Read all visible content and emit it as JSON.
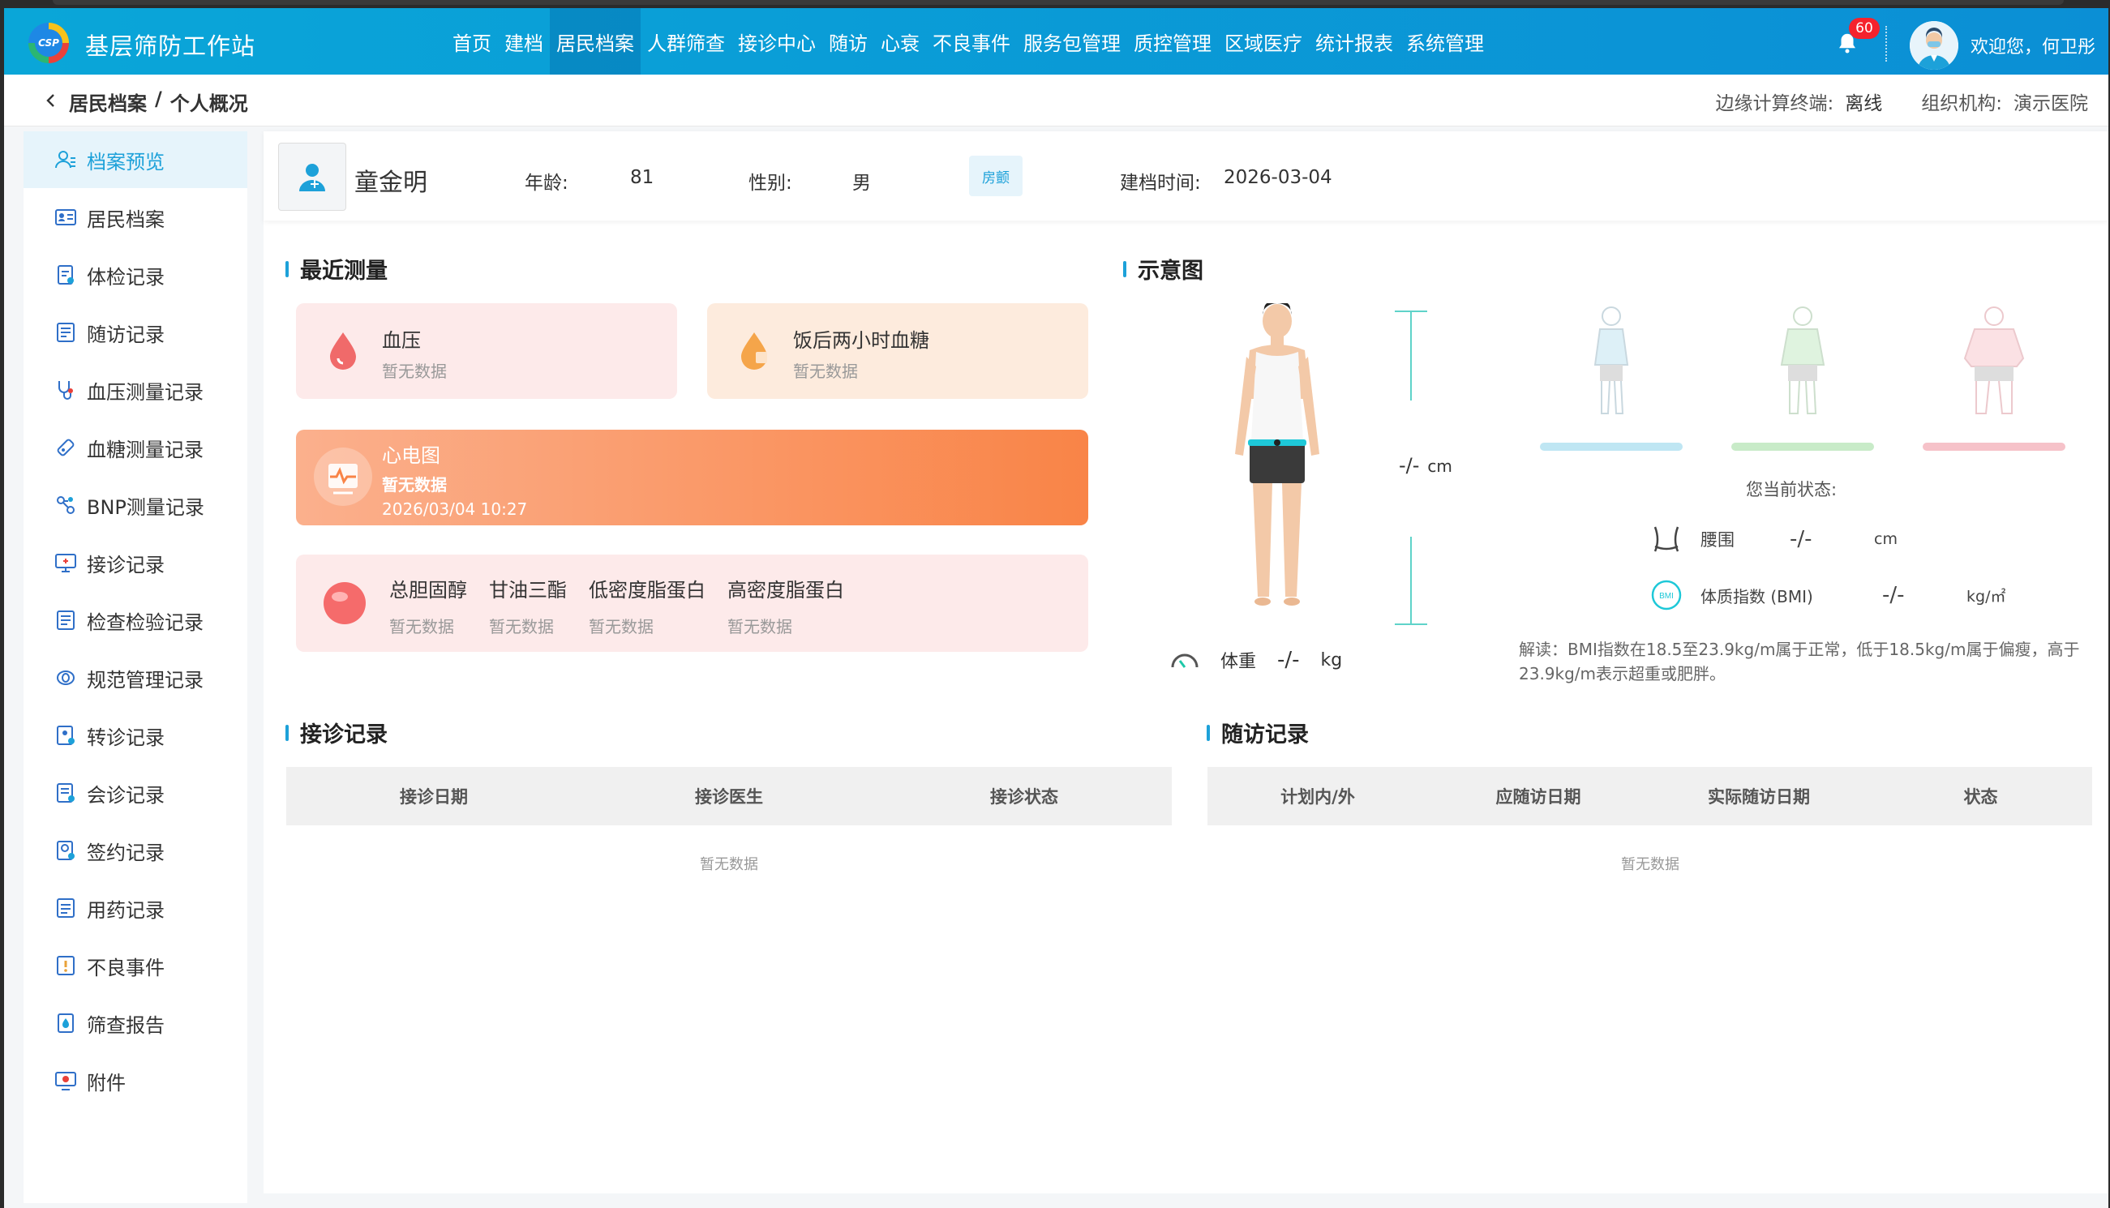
{
  "app": {
    "title": "基层筛防工作站",
    "logo_text": "CSP"
  },
  "nav": {
    "items": [
      "首页",
      "建档",
      "居民档案",
      "人群筛查",
      "接诊中心",
      "随访",
      "心衰",
      "不良事件",
      "服务包管理",
      "质控管理",
      "区域医疗",
      "统计报表",
      "系统管理"
    ],
    "active": "居民档案",
    "notification_count": "60",
    "welcome": "欢迎您，何卫彤"
  },
  "breadcrumb": {
    "parent": "居民档案",
    "separator": "/",
    "current": "个人概况"
  },
  "edge": {
    "terminal_label": "边缘计算终端:",
    "terminal_value": "离线",
    "org_label": "组织机构:",
    "org_value": "演示医院"
  },
  "sidebar": {
    "items": [
      {
        "label": "档案预览",
        "icon": "user-profile-icon",
        "active": true
      },
      {
        "label": "居民档案",
        "icon": "id-card-icon"
      },
      {
        "label": "体检记录",
        "icon": "checkup-icon"
      },
      {
        "label": "随访记录",
        "icon": "followup-icon"
      },
      {
        "label": "血压测量记录",
        "icon": "stethoscope-icon"
      },
      {
        "label": "血糖测量记录",
        "icon": "test-strip-icon"
      },
      {
        "label": "BNP测量记录",
        "icon": "molecule-icon"
      },
      {
        "label": "接诊记录",
        "icon": "monitor-icon"
      },
      {
        "label": "检查检验记录",
        "icon": "report-icon"
      },
      {
        "label": "规范管理记录",
        "icon": "capsule-icon"
      },
      {
        "label": "转诊记录",
        "icon": "referral-icon"
      },
      {
        "label": "会诊记录",
        "icon": "consult-icon"
      },
      {
        "label": "签约记录",
        "icon": "contract-icon"
      },
      {
        "label": "用药记录",
        "icon": "medication-icon"
      },
      {
        "label": "不良事件",
        "icon": "incident-icon"
      },
      {
        "label": "筛查报告",
        "icon": "screening-icon"
      },
      {
        "label": "附件",
        "icon": "attachment-icon"
      }
    ]
  },
  "patient": {
    "name": "童金明",
    "age_label": "年龄:",
    "age": "81",
    "gender_label": "性别:",
    "gender": "男",
    "tag": "房颤",
    "created_label": "建档时间:",
    "created": "2026-03-04"
  },
  "measurements": {
    "title": "最近测量",
    "bp": {
      "title": "血压",
      "status": "暂无数据"
    },
    "glucose": {
      "title": "饭后两小时血糖",
      "status": "暂无数据"
    },
    "ecg": {
      "title": "心电图",
      "status": "暂无数据",
      "datetime": "2026/03/04 10:27"
    },
    "lipids": [
      {
        "title": "总胆固醇",
        "status": "暂无数据"
      },
      {
        "title": "甘油三酯",
        "status": "暂无数据"
      },
      {
        "title": "低密度脂蛋白",
        "status": "暂无数据"
      },
      {
        "title": "高密度脂蛋白",
        "status": "暂无数据"
      }
    ]
  },
  "diagram": {
    "title": "示意图",
    "height_value": "-/-",
    "height_unit": "cm",
    "weight_label": "体重",
    "weight_value": "-/-",
    "weight_unit": "kg",
    "status_label": "您当前状态:",
    "waist_label": "腰围",
    "waist_value": "-/-",
    "waist_unit": "cm",
    "bmi_icon_text": "BMI",
    "bmi_label": "体质指数 (BMI)",
    "bmi_value": "-/-",
    "bmi_unit": "kg/㎡",
    "note": "解读：BMI指数在18.5至23.9kg/m属于正常，低于18.5kg/m属于偏瘦，高于23.9kg/m表示超重或肥胖。",
    "body_type_colors": [
      "#bfe6f3",
      "#c8ebc8",
      "#f6c2c9"
    ]
  },
  "visits": {
    "title": "接诊记录",
    "columns": [
      "接诊日期",
      "接诊医生",
      "接诊状态"
    ],
    "empty": "暂无数据"
  },
  "followups": {
    "title": "随访记录",
    "columns": [
      "计划内/外",
      "应随访日期",
      "实际随访日期",
      "状态"
    ],
    "empty": "暂无数据"
  },
  "colors": {
    "primary": "#1da1d9",
    "nav_gradient_start": "#0aa6d8",
    "nav_gradient_end": "#0b8fd5",
    "ecg_gradient_end": "#f98447",
    "badge": "#f5222d"
  }
}
